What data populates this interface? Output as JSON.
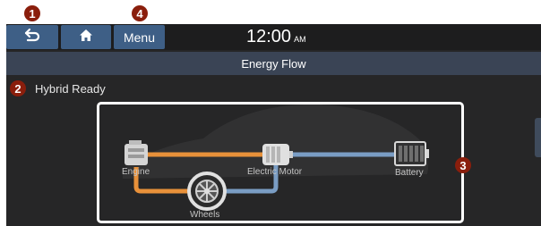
{
  "callouts": {
    "c1": "1",
    "c2": "2",
    "c3": "3",
    "c4": "4"
  },
  "header": {
    "back_icon": "back-arrow-icon",
    "home_icon": "home-icon",
    "menu_label": "Menu",
    "time": "12:00",
    "ampm": "AM"
  },
  "title": "Energy Flow",
  "status": "Hybrid Ready",
  "flow": {
    "engine_label": "Engine",
    "motor_label": "Electric Motor",
    "battery_label": "Battery",
    "wheels_label": "Wheels"
  },
  "colors": {
    "button": "#3e5f86",
    "title_bar": "#3a4455",
    "screen_bg": "#262627",
    "engine_flow": "#e8913a",
    "battery_flow": "#7a9dc4",
    "callout": "#8a1e0c"
  }
}
